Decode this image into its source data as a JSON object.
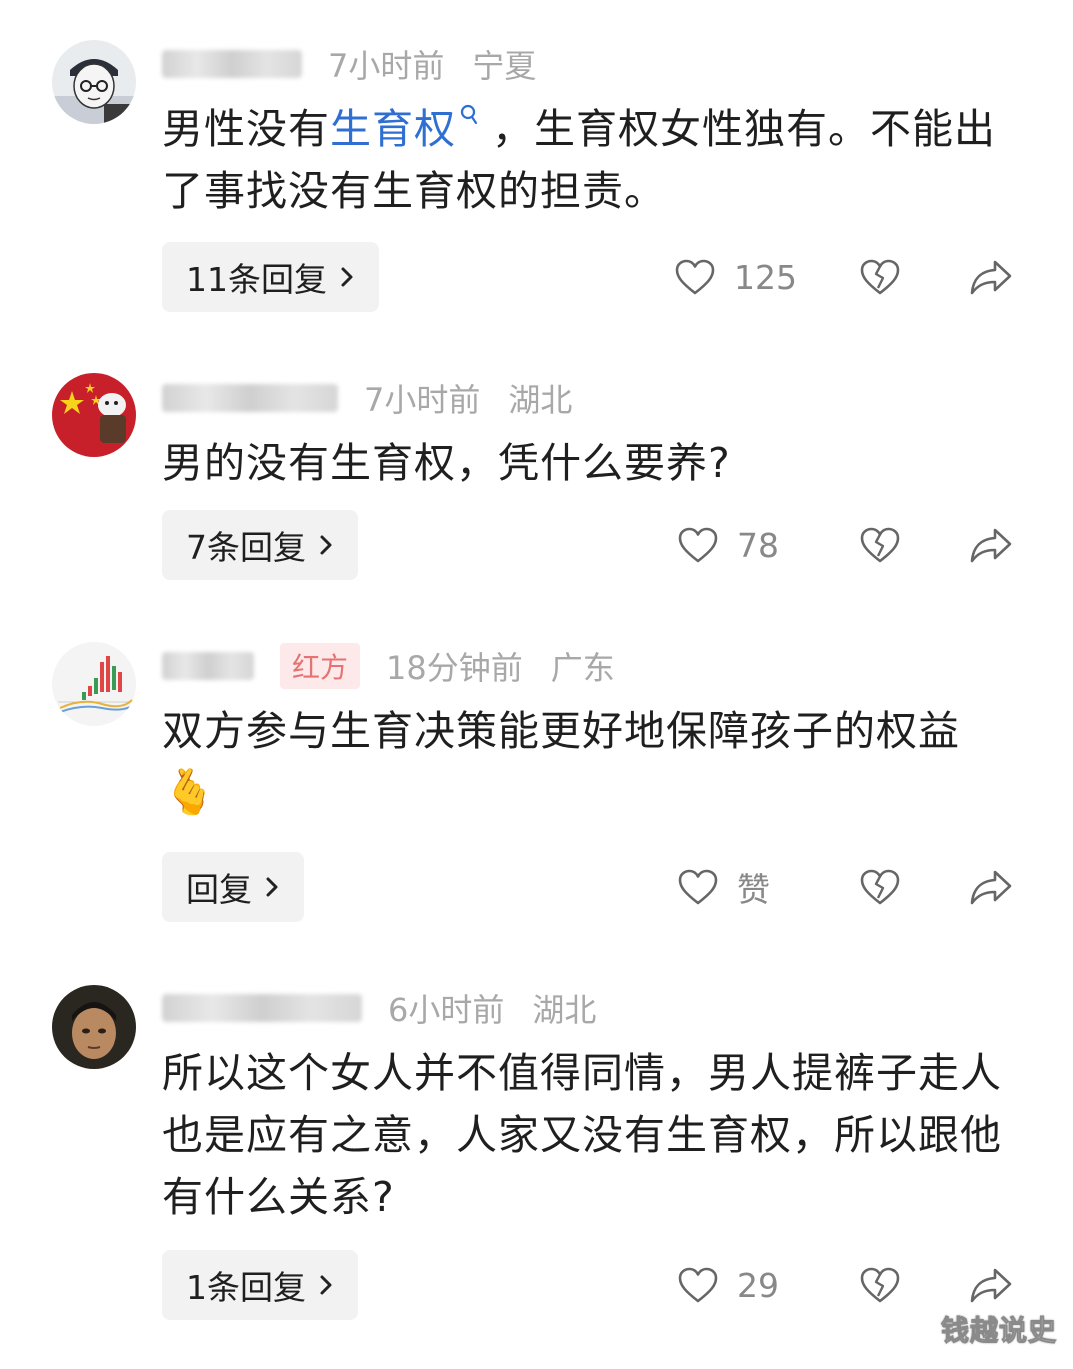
{
  "comments": [
    {
      "time": "7小时前",
      "location": "宁夏",
      "tag": "",
      "text_before": "男性没有",
      "text_link": "生育权",
      "text_after": "，生育权女性独有。不能出了事找没有生育权的担责。",
      "reply_label": "11条回复",
      "likes": "125"
    },
    {
      "time": "7小时前",
      "location": "湖北",
      "tag": "",
      "text": "男的没有生育权，凭什么要养?",
      "reply_label": "7条回复",
      "likes": "78"
    },
    {
      "time": "18分钟前",
      "location": "广东",
      "tag": "红方",
      "text": "双方参与生育决策能更好地保障孩子的权益",
      "emoji": "🫰",
      "reply_label": "回复",
      "likes": "赞"
    },
    {
      "time": "6小时前",
      "location": "湖北",
      "tag": "",
      "text": "所以这个女人并不值得同情，男人提裤子走人也是应有之意，人家又没有生育权，所以跟他有什么关系?",
      "reply_label": "1条回复",
      "likes": "29"
    }
  ],
  "watermark": "钱越说史",
  "colors": {
    "link": "#2f6fd1",
    "meta": "#a8a8a8",
    "reply_bg": "#f2f2f2",
    "tag_bg": "#fde9e9",
    "tag_text": "#e57373"
  },
  "icons": [
    "heart-icon",
    "broken-heart-icon",
    "share-icon",
    "chevron-right-icon",
    "search-icon"
  ]
}
